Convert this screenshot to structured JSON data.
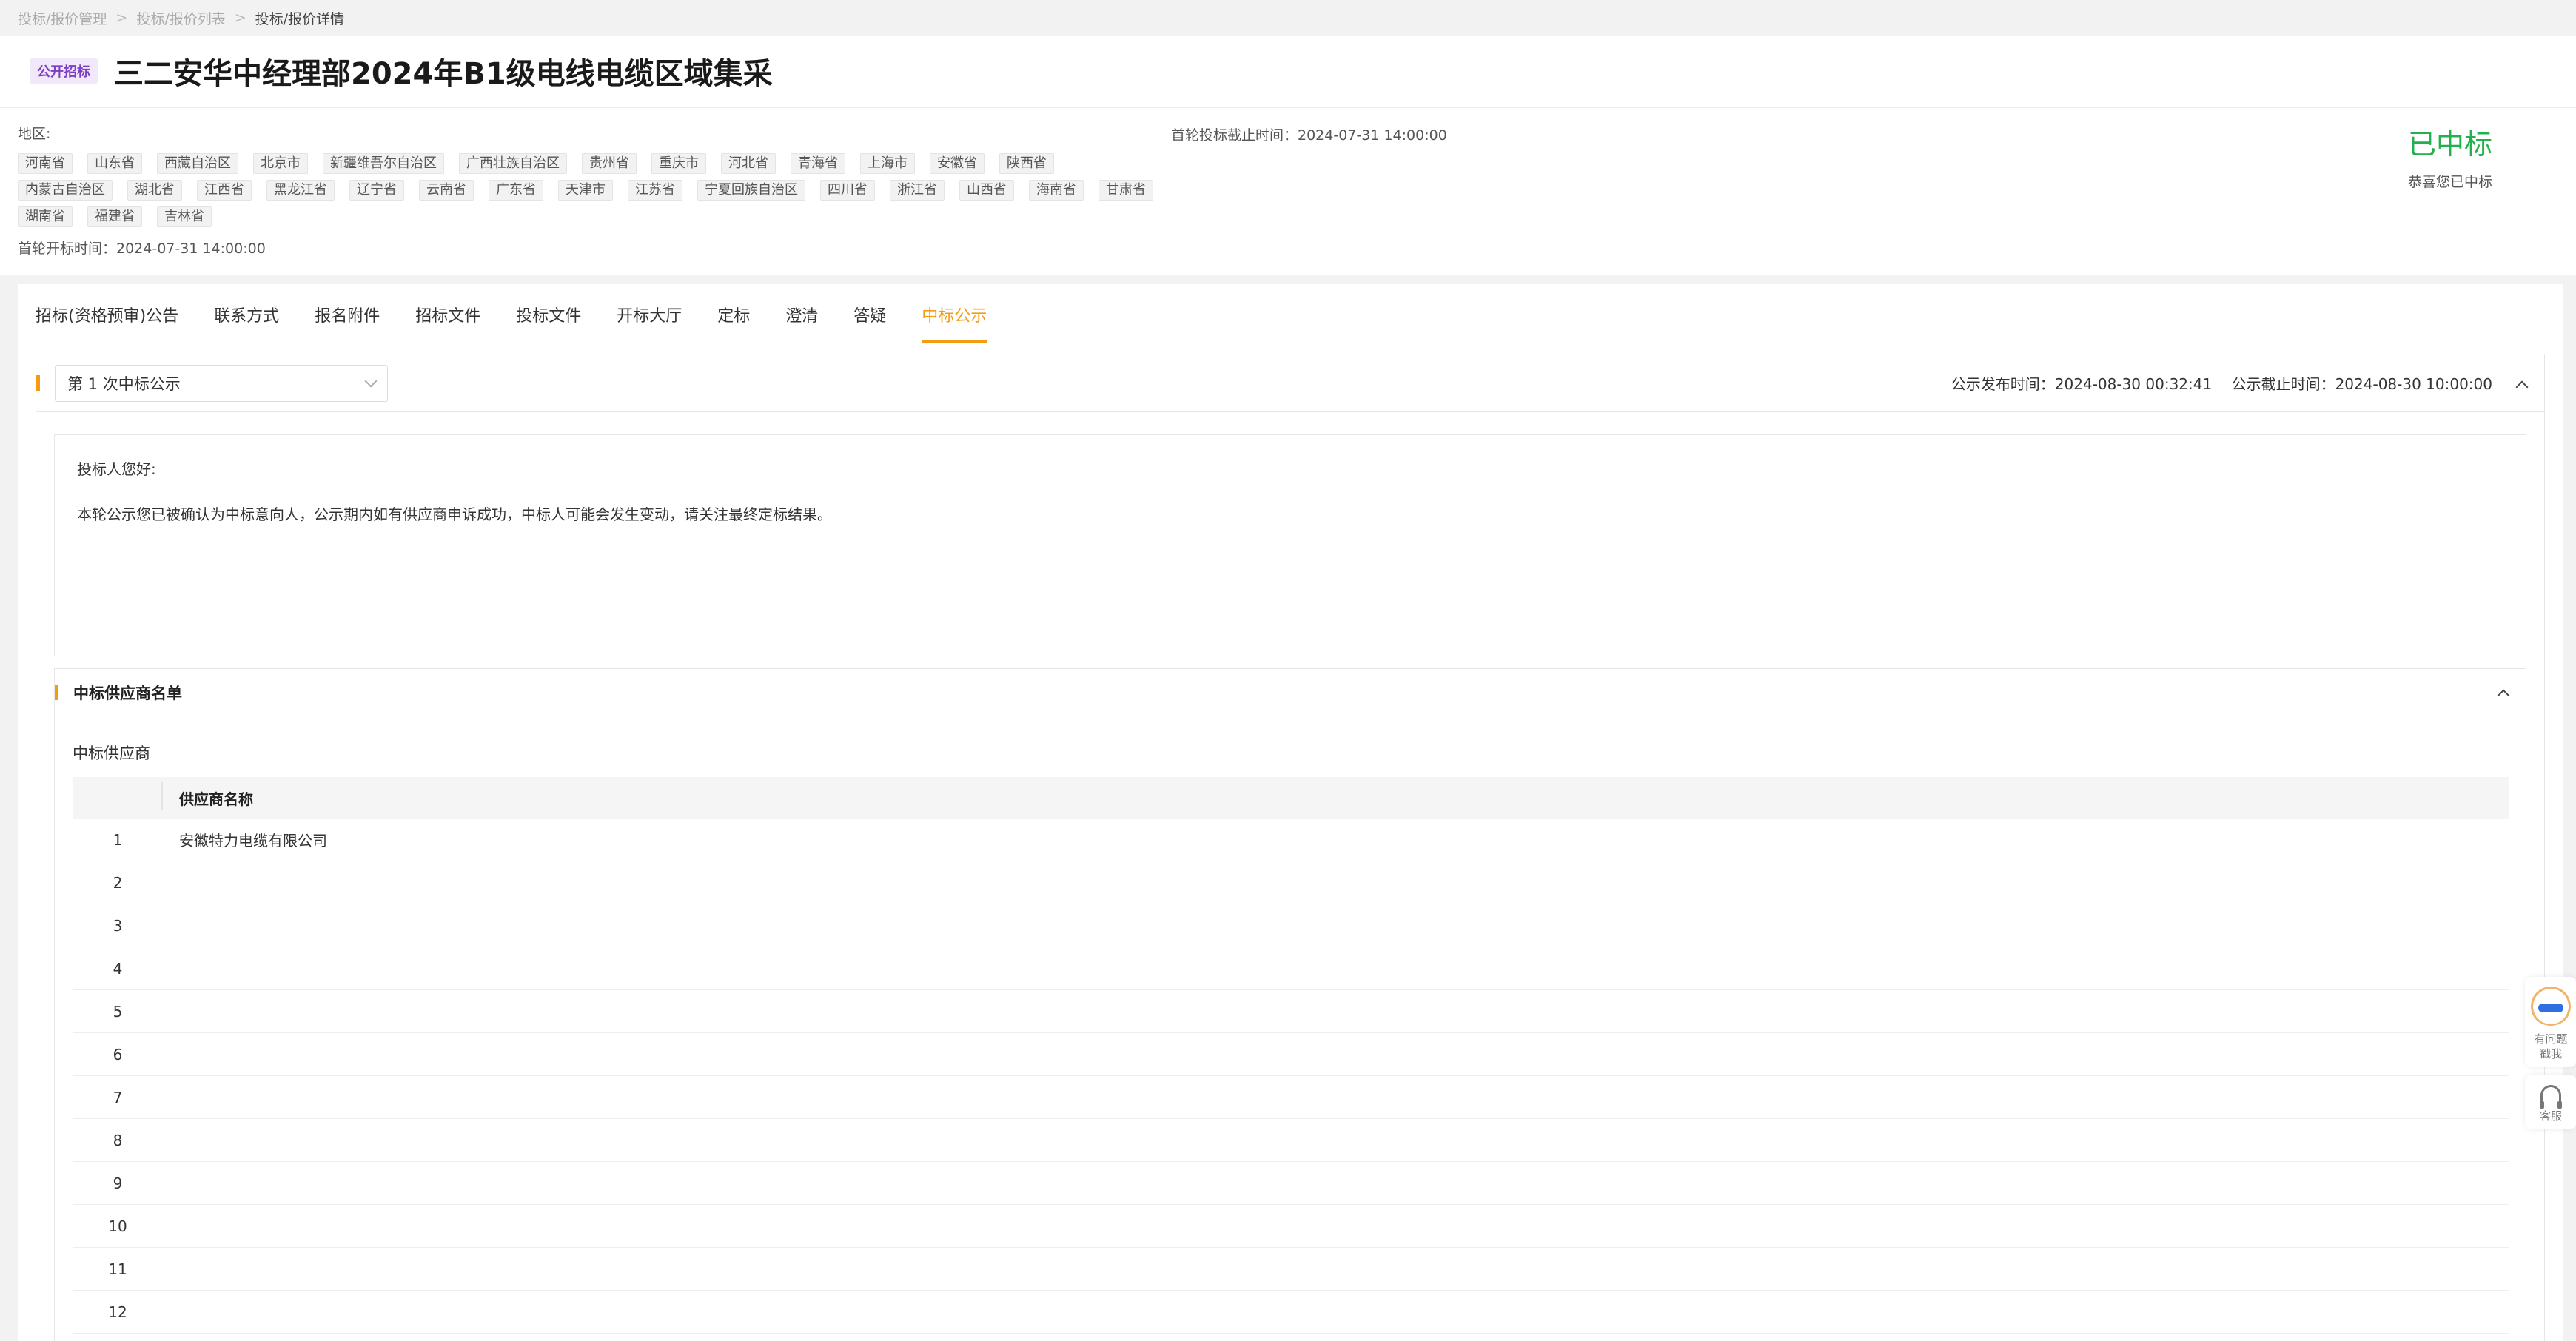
{
  "breadcrumb": {
    "items": [
      "投标/报价管理",
      "投标/报价列表"
    ],
    "current": "投标/报价详情"
  },
  "header": {
    "tag": "公开招标",
    "title": "三二安华中经理部2024年B1级电线电缆区域集采"
  },
  "info": {
    "region_label": "地区:",
    "regions": [
      "河南省",
      "山东省",
      "西藏自治区",
      "北京市",
      "新疆维吾尔自治区",
      "广西壮族自治区",
      "贵州省",
      "重庆市",
      "河北省",
      "青海省",
      "上海市",
      "安徽省",
      "陕西省",
      "内蒙古自治区",
      "湖北省",
      "江西省",
      "黑龙江省",
      "辽宁省",
      "云南省",
      "广东省",
      "天津市",
      "江苏省",
      "宁夏回族自治区",
      "四川省",
      "浙江省",
      "山西省",
      "海南省",
      "甘肃省",
      "湖南省",
      "福建省",
      "吉林省"
    ],
    "open_time": "首轮开标时间：2024-07-31 14:00:00",
    "deadline": "首轮投标截止时间：2024-07-31 14:00:00",
    "status": "已中标",
    "status_sub": "恭喜您已中标",
    "status_color": "#22b14c"
  },
  "tabs": [
    {
      "label": "招标(资格预审)公告"
    },
    {
      "label": "联系方式"
    },
    {
      "label": "报名附件"
    },
    {
      "label": "招标文件"
    },
    {
      "label": "投标文件"
    },
    {
      "label": "开标大厅"
    },
    {
      "label": "定标"
    },
    {
      "label": "澄清"
    },
    {
      "label": "答疑"
    },
    {
      "label": "中标公示"
    }
  ],
  "active_tab": "中标公示",
  "accent_color": "#f39c12",
  "notice": {
    "select_value": "第 1 次中标公示",
    "publish_time": "公示发布时间：2024-08-30 00:32:41",
    "end_time": "公示截止时间：2024-08-30 10:00:00",
    "greeting": "投标人您好:",
    "message": "本轮公示您已被确认为中标意向人，公示期内如有供应商申诉成功，中标人可能会发生变动，请关注最终定标结果。"
  },
  "suppliers": {
    "title": "中标供应商名单",
    "subtitle": "中标供应商",
    "column_header": "供应商名称",
    "rows": [
      {
        "num": "1",
        "name": "安徽特力电缆有限公司"
      },
      {
        "num": "2",
        "name": ""
      },
      {
        "num": "3",
        "name": ""
      },
      {
        "num": "4",
        "name": ""
      },
      {
        "num": "5",
        "name": ""
      },
      {
        "num": "6",
        "name": ""
      },
      {
        "num": "7",
        "name": ""
      },
      {
        "num": "8",
        "name": ""
      },
      {
        "num": "9",
        "name": ""
      },
      {
        "num": "10",
        "name": ""
      },
      {
        "num": "11",
        "name": ""
      },
      {
        "num": "12",
        "name": ""
      }
    ]
  },
  "float": {
    "feedback": "有问题\n戳我",
    "service": "客服"
  }
}
